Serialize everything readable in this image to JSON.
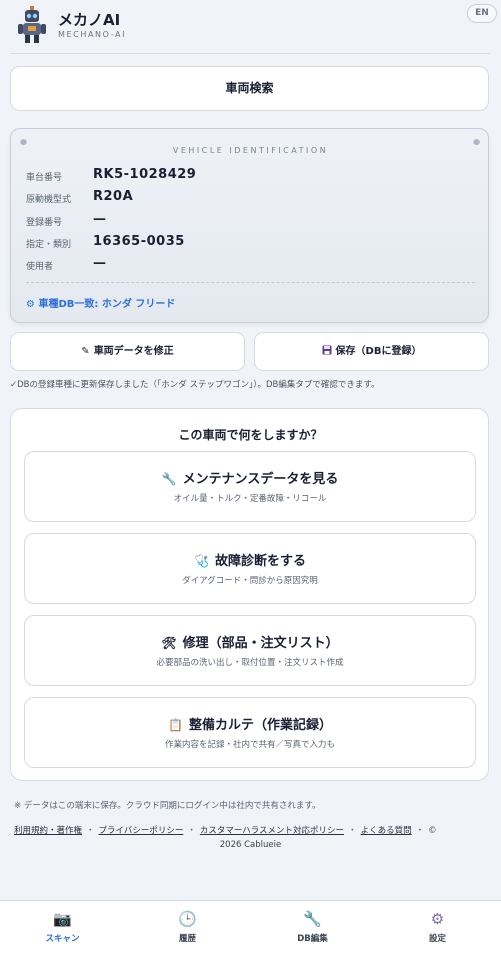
{
  "app": {
    "title": "メカノAI",
    "subtitle": "MECHANO-AI",
    "lang_button": "EN"
  },
  "search": {
    "label": "車両検索"
  },
  "vehicle": {
    "card_title": "VEHICLE IDENTIFICATION",
    "rows": [
      {
        "label": "車台番号",
        "value": "RK5-1028429"
      },
      {
        "label": "原動機型式",
        "value": "R20A"
      },
      {
        "label": "登録番号",
        "value": "—"
      },
      {
        "label": "指定・類別",
        "value": "16365-0035"
      },
      {
        "label": "使用者",
        "value": "—"
      }
    ],
    "db_match": "⚙ 車種DB一致: ホンダ フリード"
  },
  "actions": {
    "edit_label": "車両データを修正",
    "edit_icon": "pencil-icon",
    "save_label": "保存（DBに登録）",
    "save_icon": "floppy-disk-icon",
    "saved_message": "✓DBの登録車種に更新保存しました（「ホンダ ステップワゴン」）。DB編集タブで確認できます。"
  },
  "menu": {
    "question": "この車両で何をしますか？",
    "items": [
      {
        "title": "メンテナンスデータを見る",
        "subtitle": "オイル量・トルク・定番故障・リコール",
        "icon": "🔧",
        "icon_name": "wrench-icon"
      },
      {
        "title": "故障診断をする",
        "subtitle": "ダイアグコード・問診から原因究明",
        "icon": "🩺",
        "icon_name": "stethoscope-icon"
      },
      {
        "title": "修理（部品・注文リスト）",
        "subtitle": "必要部品の洗い出し・取付位置・注文リスト作成",
        "icon": "🛠",
        "icon_name": "tools-icon"
      },
      {
        "title": "整備カルテ（作業記録）",
        "subtitle": "作業内容を記録・社内で共有／写真で入力も",
        "icon": "📋",
        "icon_name": "clipboard-icon"
      }
    ]
  },
  "footer": {
    "note": "※ データはこの端末に保存。クラウド同期にログイン中は社内で共有されます。",
    "links": [
      "利用規約・著作権",
      "プライバシーポリシー",
      "カスタマーハラスメント対応ポリシー",
      "よくある質問"
    ],
    "copyright_symbol": "©",
    "copyright": "2026 Cablueie"
  },
  "nav": [
    {
      "label": "スキャン",
      "icon": "📷",
      "icon_name": "camera-icon",
      "active": true
    },
    {
      "label": "履歴",
      "icon": "🕒",
      "icon_name": "clock-icon",
      "active": false
    },
    {
      "label": "DB編集",
      "icon": "🔧",
      "icon_name": "wrench-icon",
      "active": false
    },
    {
      "label": "設定",
      "icon": "⚙",
      "icon_name": "gear-icon",
      "active": false
    }
  ],
  "colors": {
    "accent": "#2b6fd8",
    "background": "#f0f3f8",
    "card": "#ffffff"
  }
}
